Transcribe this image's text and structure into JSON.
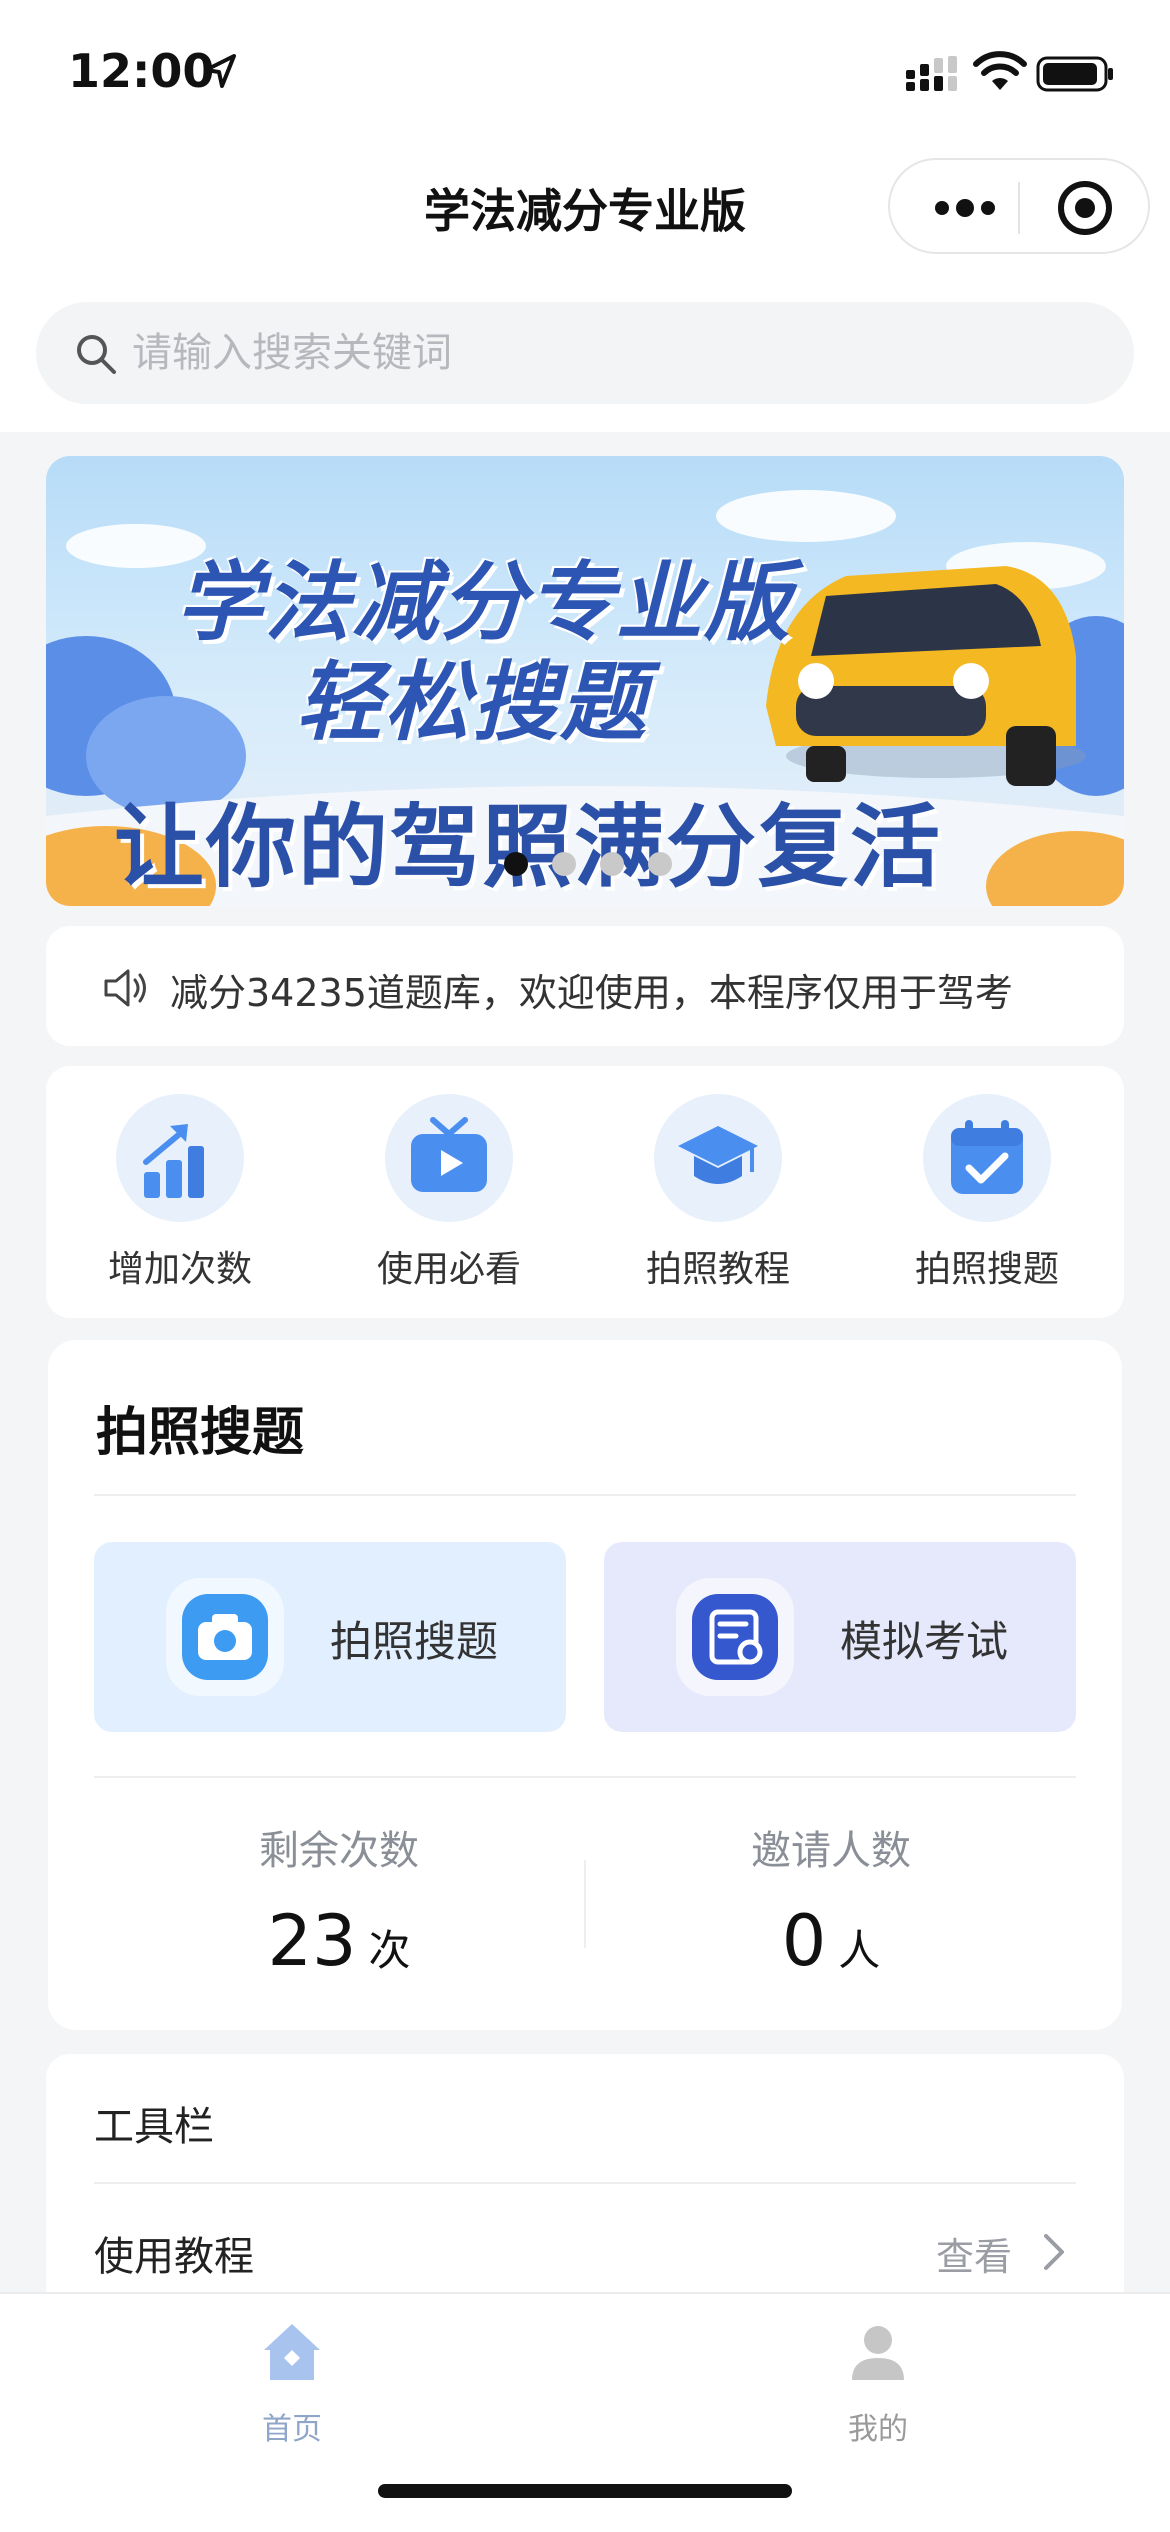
{
  "status_bar": {
    "time": "12:00"
  },
  "nav": {
    "title": "学法减分专业版"
  },
  "search": {
    "placeholder": "请输入搜索关键词"
  },
  "banner": {
    "line1": "学法减分专业版",
    "line2": "轻松搜题",
    "line3": "让你的驾照满分复活",
    "slides": 4,
    "active_slide": 1
  },
  "notice": {
    "text": "减分34235道题库，欢迎使用，本程序仅用于驾考"
  },
  "quick_menu": [
    {
      "label": "增加次数",
      "icon": "growth-chart-icon"
    },
    {
      "label": "使用必看",
      "icon": "tv-play-icon"
    },
    {
      "label": "拍照教程",
      "icon": "graduation-cap-icon"
    },
    {
      "label": "拍照搜题",
      "icon": "calendar-check-icon"
    }
  ],
  "photo_search": {
    "title": "拍照搜题",
    "actions": [
      {
        "label": "拍照搜题",
        "icon": "camera-icon"
      },
      {
        "label": "模拟考试",
        "icon": "exam-paper-icon"
      }
    ],
    "stats": [
      {
        "label": "剩余次数",
        "value": "23",
        "unit": "次"
      },
      {
        "label": "邀请人数",
        "value": "0",
        "unit": "人"
      }
    ]
  },
  "toolbar": {
    "title": "工具栏",
    "rows": [
      {
        "label": "使用教程",
        "action": "查看"
      }
    ]
  },
  "tabbar": {
    "items": [
      {
        "label": "首页",
        "active": true
      },
      {
        "label": "我的",
        "active": false
      }
    ]
  },
  "colors": {
    "accent_blue": "#4a8ff0",
    "banner_text": "#2d55b3",
    "page_bg": "#f4f5f7"
  }
}
